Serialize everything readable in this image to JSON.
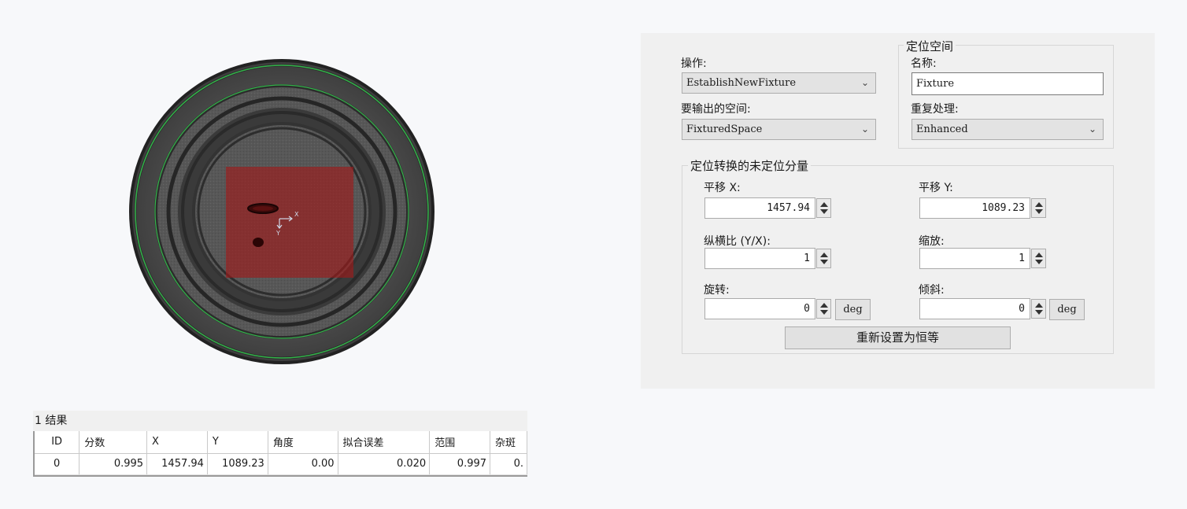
{
  "image_view": {
    "overlay_axis_x": "X",
    "overlay_axis_y": "Y"
  },
  "results": {
    "title": "1 结果",
    "columns": [
      "ID",
      "分数",
      "X",
      "Y",
      "角度",
      "拟合误差",
      "范围",
      "杂斑"
    ],
    "rows": [
      [
        "0",
        "0.995",
        "1457.94",
        "1089.23",
        "0.00",
        "0.020",
        "0.997",
        "0."
      ]
    ]
  },
  "settings": {
    "operation_label": "操作:",
    "operation_value": "EstablishNewFixture",
    "output_space_label": "要输出的空间:",
    "output_space_value": "FixturedSpace",
    "fixture_space_group": "定位空间",
    "name_label": "名称:",
    "name_value": "Fixture",
    "repeat_label": "重复处理:",
    "repeat_value": "Enhanced",
    "transform_group": "定位转换的未定位分量",
    "translate_x_label": "平移 X:",
    "translate_x_value": "1457.94",
    "translate_y_label": "平移 Y:",
    "translate_y_value": "1089.23",
    "aspect_label": "纵横比 (Y/X):",
    "aspect_value": "1",
    "scale_label": "缩放:",
    "scale_value": "1",
    "rotation_label": "旋转:",
    "rotation_value": "0",
    "rotation_unit": "deg",
    "skew_label": "倾斜:",
    "skew_value": "0",
    "skew_unit": "deg",
    "reset_button": "重新设置为恒等"
  }
}
